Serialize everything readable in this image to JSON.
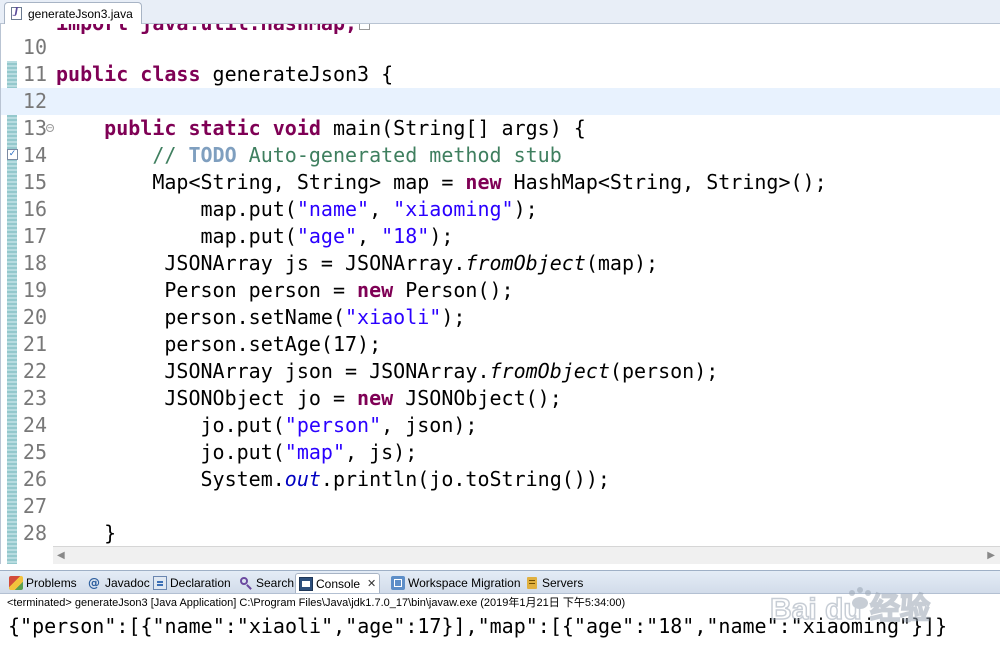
{
  "editor": {
    "tab_label": "generateJson3.java",
    "tab_close": "✕",
    "partial_top_line": "import java.util.HashMap;"
  },
  "code_lines": [
    {
      "num": "10"
    },
    {
      "num": "11"
    },
    {
      "num": "12"
    },
    {
      "num": "13"
    },
    {
      "num": "14"
    },
    {
      "num": "15"
    },
    {
      "num": "16"
    },
    {
      "num": "17"
    },
    {
      "num": "18"
    },
    {
      "num": "19"
    },
    {
      "num": "20"
    },
    {
      "num": "21"
    },
    {
      "num": "22"
    },
    {
      "num": "23"
    },
    {
      "num": "24"
    },
    {
      "num": "25"
    },
    {
      "num": "26"
    },
    {
      "num": "27"
    },
    {
      "num": "28"
    }
  ],
  "code": {
    "l11_kw1": "public",
    "l11_kw2": "class",
    "l11_rest": " generateJson3 {",
    "l13_kw1": "public",
    "l13_kw2": "static",
    "l13_kw3": "void",
    "l13_rest": " main(String[] args) {",
    "l14_c1": "// ",
    "l14_todo": "TODO",
    "l14_c2": " Auto-generated method stub",
    "l15_a": "Map<String, String> map = ",
    "l15_kw": "new",
    "l15_b": " HashMap<String, String>();",
    "l16_a": "map.put(",
    "l16_s1": "\"name\"",
    "l16_m": ", ",
    "l16_s2": "\"xiaoming\"",
    "l16_e": ");",
    "l17_a": "map.put(",
    "l17_s1": "\"age\"",
    "l17_m": ", ",
    "l17_s2": "\"18\"",
    "l17_e": ");",
    "l18_a": "JSONArray js = JSONArray.",
    "l18_i": "fromObject",
    "l18_b": "(map);",
    "l19_a": "Person person = ",
    "l19_kw": "new",
    "l19_b": " Person();",
    "l20_a": "person.setName(",
    "l20_s": "\"xiaoli\"",
    "l20_b": ");",
    "l21": "person.setAge(17);",
    "l22_a": "JSONArray json = JSONArray.",
    "l22_i": "fromObject",
    "l22_b": "(person);",
    "l23_a": "JSONObject jo = ",
    "l23_kw": "new",
    "l23_b": " JSONObject();",
    "l24_a": "jo.put(",
    "l24_s": "\"person\"",
    "l24_b": ", json);",
    "l25_a": "jo.put(",
    "l25_s": "\"map\"",
    "l25_b": ", js);",
    "l26_a": "System.",
    "l26_f": "out",
    "l26_b": ".println(jo.toString());",
    "l28": "}"
  },
  "views": {
    "tabs": [
      {
        "label": "Problems",
        "icon": "problems-icon"
      },
      {
        "label": "Javadoc",
        "icon": "javadoc-icon"
      },
      {
        "label": "Declaration",
        "icon": "declaration-icon"
      },
      {
        "label": "Search",
        "icon": "search-icon"
      },
      {
        "label": "Console",
        "icon": "console-icon",
        "active": true
      },
      {
        "label": "Workspace Migration",
        "icon": "migration-icon"
      },
      {
        "label": "Servers",
        "icon": "servers-icon"
      }
    ],
    "console_close": "✕"
  },
  "console": {
    "header": "<terminated> generateJson3 [Java Application] C:\\Program Files\\Java\\jdk1.7.0_17\\bin\\javaw.exe (2019年1月21日 下午5:34:00)",
    "output": "{\"person\":[{\"name\":\"xiaoli\",\"age\":17}],\"map\":[{\"age\":\"18\",\"name\":\"xiaoming\"}]}"
  },
  "watermark": {
    "text": "Bai du 经验"
  },
  "colors": {
    "keyword": "#7f0055",
    "string": "#2a00ff",
    "comment": "#3f7f5f",
    "todo": "#7f9fbf",
    "current_line": "#e8f2fe"
  }
}
